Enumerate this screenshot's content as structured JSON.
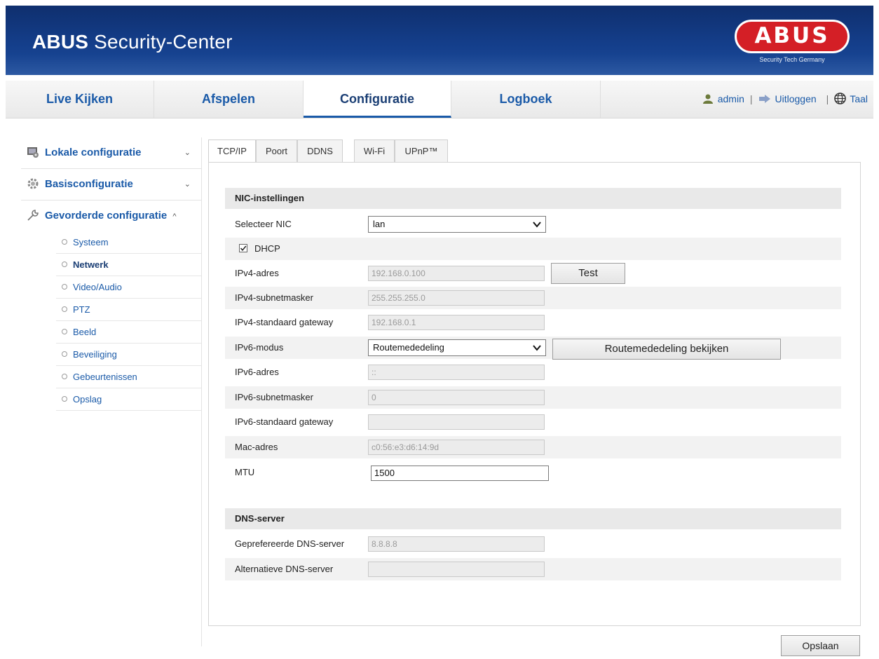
{
  "header": {
    "title_bold": "ABUS",
    "title_rest": " Security-Center",
    "logo_text": "ABUS",
    "logo_sub": "Security Tech Germany"
  },
  "nav": {
    "tabs": [
      "Live Kijken",
      "Afspelen",
      "Configuratie",
      "Logboek"
    ],
    "active_tab": "Configuratie",
    "user": "admin",
    "separator": "|",
    "logout": "Uitloggen",
    "language": "Taal"
  },
  "sidebar": {
    "sections": [
      {
        "label": "Lokale configuratie",
        "icon": "monitor-gear-icon",
        "chevron": "⌄"
      },
      {
        "label": "Basisconfiguratie",
        "icon": "gear-icon",
        "chevron": "⌄"
      },
      {
        "label": "Gevorderde configuratie",
        "icon": "wrench-icon",
        "chevron": "^"
      }
    ],
    "items": [
      "Systeem",
      "Netwerk",
      "Video/Audio",
      "PTZ",
      "Beeld",
      "Beveiliging",
      "Gebeurtenissen",
      "Opslag"
    ],
    "active_item": "Netwerk"
  },
  "content_tabs": [
    "TCP/IP",
    "Poort",
    "DDNS",
    "Wi-Fi",
    "UPnP™"
  ],
  "active_content_tab": "TCP/IP",
  "nic": {
    "heading": "NIC-instellingen",
    "select_nic_label": "Selecteer NIC",
    "select_nic_value": "lan",
    "dhcp_label": "DHCP",
    "dhcp_checked": true,
    "ipv4_address_label": "IPv4-adres",
    "ipv4_address": "192.168.0.100",
    "test_button": "Test",
    "ipv4_subnet_label": "IPv4-subnetmasker",
    "ipv4_subnet": "255.255.255.0",
    "ipv4_gateway_label": "IPv4-standaard gateway",
    "ipv4_gateway": "192.168.0.1",
    "ipv6_mode_label": "IPv6-modus",
    "ipv6_mode_value": "Routemededeling",
    "view_route_button": "Routemededeling bekijken",
    "ipv6_address_label": "IPv6-adres",
    "ipv6_address": "::",
    "ipv6_subnet_label": "IPv6-subnetmasker",
    "ipv6_subnet": "0",
    "ipv6_gateway_label": "IPv6-standaard gateway",
    "ipv6_gateway": "",
    "mac_label": "Mac-adres",
    "mac_value": "c0:56:e3:d6:14:9d",
    "mtu_label": "MTU",
    "mtu_value": "1500"
  },
  "dns": {
    "heading": "DNS-server",
    "preferred_label": "Geprefereerde DNS-server",
    "preferred_value": "8.8.8.8",
    "alternate_label": "Alternatieve DNS-server",
    "alternate_value": ""
  },
  "save_button": "Opslaan",
  "colors": {
    "header_blue": "#143e8a",
    "link_blue": "#1a5aa8",
    "logo_red": "#d41f26"
  }
}
